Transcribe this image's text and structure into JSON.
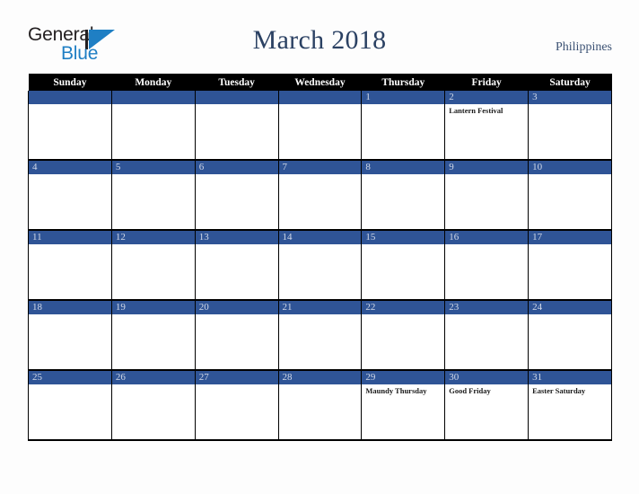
{
  "brand": {
    "logo_word1": "General",
    "logo_word2": "Blue",
    "logo_mark_icon": "triangle-icon"
  },
  "header": {
    "title": "March 2018",
    "country": "Philippines"
  },
  "colors": {
    "band_blue": "#2f5496",
    "header_black": "#000000",
    "title_navy": "#2b4163",
    "logo_blue": "#1f7fc4",
    "page_background": "#fdfdfd"
  },
  "calendar": {
    "weekday_headers": [
      "Sunday",
      "Monday",
      "Tuesday",
      "Wednesday",
      "Thursday",
      "Friday",
      "Saturday"
    ],
    "weeks": [
      [
        {
          "day": "",
          "events": []
        },
        {
          "day": "",
          "events": []
        },
        {
          "day": "",
          "events": []
        },
        {
          "day": "",
          "events": []
        },
        {
          "day": "1",
          "events": []
        },
        {
          "day": "2",
          "events": [
            "Lantern Festival"
          ]
        },
        {
          "day": "3",
          "events": []
        }
      ],
      [
        {
          "day": "4",
          "events": []
        },
        {
          "day": "5",
          "events": []
        },
        {
          "day": "6",
          "events": []
        },
        {
          "day": "7",
          "events": []
        },
        {
          "day": "8",
          "events": []
        },
        {
          "day": "9",
          "events": []
        },
        {
          "day": "10",
          "events": []
        }
      ],
      [
        {
          "day": "11",
          "events": []
        },
        {
          "day": "12",
          "events": []
        },
        {
          "day": "13",
          "events": []
        },
        {
          "day": "14",
          "events": []
        },
        {
          "day": "15",
          "events": []
        },
        {
          "day": "16",
          "events": []
        },
        {
          "day": "17",
          "events": []
        }
      ],
      [
        {
          "day": "18",
          "events": []
        },
        {
          "day": "19",
          "events": []
        },
        {
          "day": "20",
          "events": []
        },
        {
          "day": "21",
          "events": []
        },
        {
          "day": "22",
          "events": []
        },
        {
          "day": "23",
          "events": []
        },
        {
          "day": "24",
          "events": []
        }
      ],
      [
        {
          "day": "25",
          "events": []
        },
        {
          "day": "26",
          "events": []
        },
        {
          "day": "27",
          "events": []
        },
        {
          "day": "28",
          "events": []
        },
        {
          "day": "29",
          "events": [
            "Maundy Thursday"
          ]
        },
        {
          "day": "30",
          "events": [
            "Good Friday"
          ]
        },
        {
          "day": "31",
          "events": [
            "Easter Saturday"
          ]
        }
      ]
    ]
  }
}
